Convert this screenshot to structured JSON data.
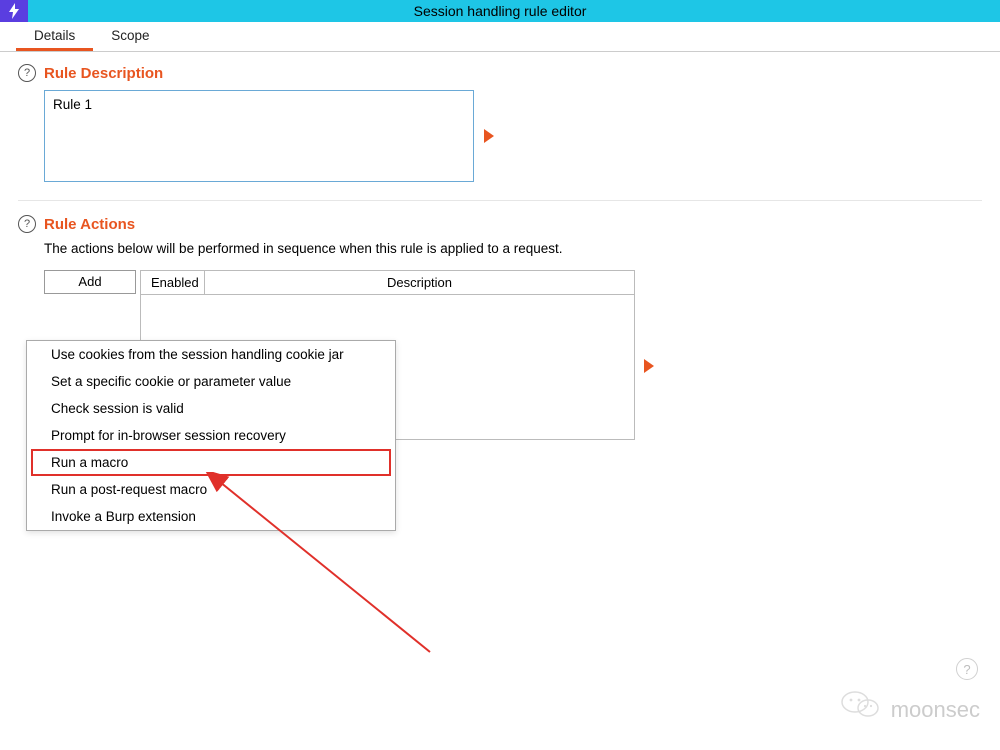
{
  "titlebar": {
    "title": "Session handling rule editor"
  },
  "tabs": {
    "details": "Details",
    "scope": "Scope"
  },
  "ruleDescription": {
    "heading": "Rule Description",
    "value": "Rule 1"
  },
  "ruleActions": {
    "heading": "Rule Actions",
    "description": "The actions below will be performed in sequence when this rule is applied to a request.",
    "addBtn": "Add",
    "columns": {
      "enabled": "Enabled",
      "description": "Description"
    },
    "menu": {
      "useCookies": "Use cookies from the session handling cookie jar",
      "setCookie": "Set a specific cookie or parameter value",
      "checkSession": "Check session is valid",
      "promptRecovery": "Prompt for in-browser session recovery",
      "runMacro": "Run a macro",
      "runPostMacro": "Run a post-request macro",
      "invokeExtension": "Invoke a Burp extension"
    }
  },
  "watermark": {
    "text": "moonsec"
  }
}
